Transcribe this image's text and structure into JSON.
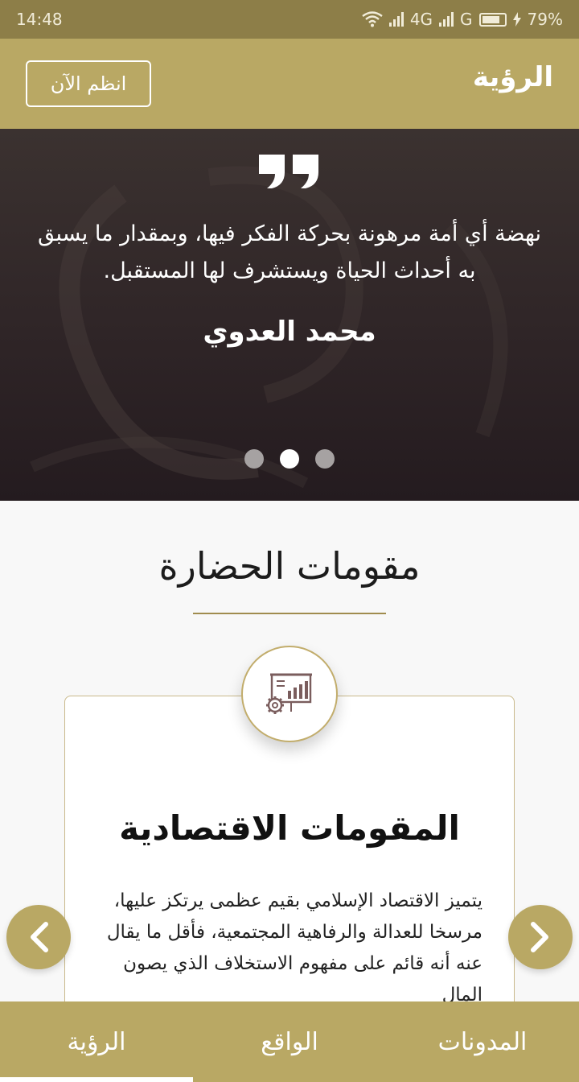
{
  "status_bar": {
    "time": "14:48",
    "network_1": "4G",
    "network_2": "G",
    "battery": "79%",
    "battery_level": 0.79
  },
  "header": {
    "title": "الرؤية",
    "join_button": "انظم الآن"
  },
  "hero": {
    "quote": "نهضة أي أمة مرهونة بحركة الفكر فيها، وبمقدار ما يسبق به أحداث الحياة ويستشرف لها المستقبل.",
    "author": "محمد العدوي",
    "slides_count": 3,
    "active_slide": 2
  },
  "section": {
    "title": "مقومات الحضارة"
  },
  "card": {
    "icon": "presentation-chart-gear-icon",
    "title": "المقومات الاقتصادية",
    "body": "يتميز الاقتصاد الإسلامي بقيم عظمى يرتكز عليها، مرسخا للعدالة والرفاهية المجتمعية، فأقل ما يقال عنه أنه قائم على مفهوم الاستخلاف الذي يصون المال"
  },
  "navigation": {
    "prev_icon": "chevron-left-icon",
    "next_icon": "chevron-right-icon"
  },
  "bottom_nav": {
    "items": [
      {
        "label": "الرؤية",
        "active": true
      },
      {
        "label": "الواقع",
        "active": false
      },
      {
        "label": "المدونات",
        "active": false
      }
    ]
  },
  "colors": {
    "primary": "#b9a864",
    "status_bar": "#8d7e48",
    "hero_dark": "#2f2527",
    "accent_line": "#a08c4e"
  }
}
